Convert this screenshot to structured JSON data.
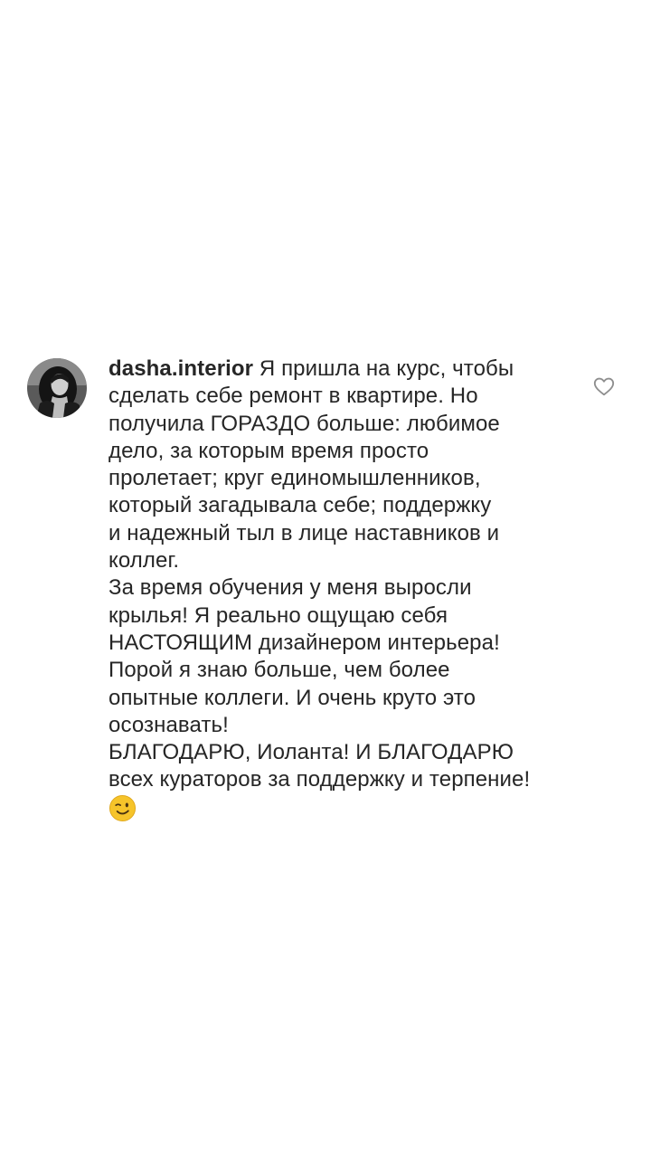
{
  "comment": {
    "username": "dasha.interior",
    "lines": [
      "Я пришла на курс, чтобы",
      "сделать себе ремонт в квартире. Но",
      "получила ГОРАЗДО больше: любимое",
      "дело, за которым время просто",
      "пролетает; круг единомышленников,",
      "который загадывала себе; поддержку",
      "и надежный тыл в лице наставников и",
      "коллег.",
      "За время обучения у меня выросли",
      "крылья! Я реально ощущаю себя",
      "НАСТОЯЩИМ дизайнером интерьера!",
      "Порой я знаю больше, чем более",
      "опытные коллеги. И очень круто это",
      "осознавать!",
      "БЛАГОДАРЮ, Иоланта! И БЛАГОДАРЮ",
      "всех кураторов за поддержку и терпение!"
    ],
    "emoji": "winking-face-emoji",
    "avatar": "profile-photo",
    "like_icon": "heart-outline-icon"
  },
  "colors": {
    "text": "#262626",
    "icon": "#8e8e8e",
    "emoji_fill": "#f6c42a"
  }
}
